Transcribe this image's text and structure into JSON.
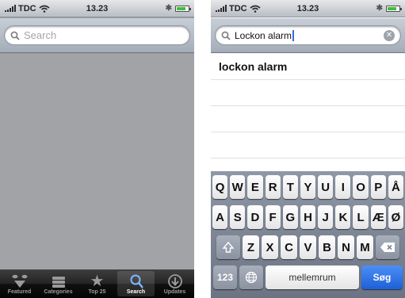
{
  "left_screen": {
    "status_bar": {
      "carrier": "TDC",
      "time": "13.23"
    },
    "search": {
      "placeholder": "Search"
    },
    "tab_bar": {
      "tabs": [
        {
          "label": "Featured",
          "icon": "featured-icon",
          "active": false
        },
        {
          "label": "Categories",
          "icon": "categories-icon",
          "active": false
        },
        {
          "label": "Top 25",
          "icon": "star-icon",
          "active": false
        },
        {
          "label": "Search",
          "icon": "search-icon",
          "active": true
        },
        {
          "label": "Updates",
          "icon": "download-icon",
          "active": false
        }
      ]
    }
  },
  "right_screen": {
    "status_bar": {
      "carrier": "TDC",
      "time": "13.23"
    },
    "search": {
      "value": "Lockon alarm"
    },
    "results": [
      "lockon alarm"
    ],
    "keyboard": {
      "row1": [
        "Q",
        "W",
        "E",
        "R",
        "T",
        "Y",
        "U",
        "I",
        "O",
        "P",
        "Å"
      ],
      "row2": [
        "A",
        "S",
        "D",
        "F",
        "G",
        "H",
        "J",
        "K",
        "L",
        "Æ",
        "Ø"
      ],
      "row3": [
        "Z",
        "X",
        "C",
        "V",
        "B",
        "N",
        "M"
      ],
      "numbers_key": "123",
      "space_key": "mellemrum",
      "go_key": "Søg"
    }
  },
  "colors": {
    "accent_blue": "#2f6fe0",
    "tab_active": "#7fb8ff",
    "battery": "#3cbf3c"
  }
}
